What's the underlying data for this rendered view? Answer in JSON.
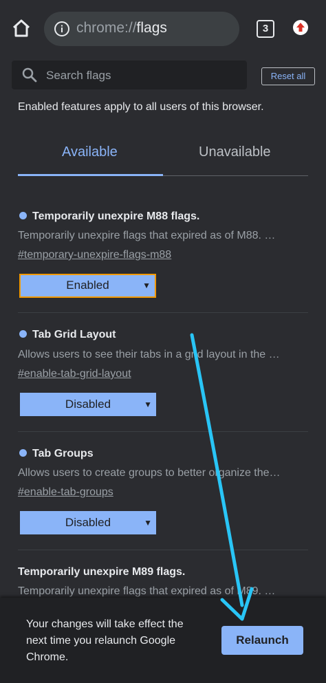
{
  "toolbar": {
    "url_scheme": "chrome://",
    "url_path": "flags",
    "tab_count": "3",
    "home_icon": "home-icon",
    "info_icon": "info-icon",
    "update_icon": "update-arrow-icon"
  },
  "search": {
    "placeholder": "Search flags",
    "value": "",
    "reset_label": "Reset all"
  },
  "notice": "Enabled features apply to all users of this browser.",
  "tabs": [
    {
      "label": "Available",
      "active": true
    },
    {
      "label": "Unavailable",
      "active": false
    }
  ],
  "flags": [
    {
      "title": "Temporarily unexpire M88 flags.",
      "description": "Temporarily unexpire flags that expired as of M88. …",
      "link": "#temporary-unexpire-flags-m88",
      "value": "Enabled",
      "dot": true
    },
    {
      "title": "Tab Grid Layout",
      "description": "Allows users to see their tabs in a grid layout in the …",
      "link": "#enable-tab-grid-layout",
      "value": "Disabled",
      "dot": true
    },
    {
      "title": "Tab Groups",
      "description": "Allows users to create groups to better organize the…",
      "link": "#enable-tab-groups",
      "value": "Disabled",
      "dot": true
    },
    {
      "title": "Temporarily unexpire M89 flags.",
      "description": "Temporarily unexpire flags that expired as of M89. …",
      "link": "",
      "value": "",
      "dot": false
    }
  ],
  "infobar": {
    "message": "Your changes will take effect the next time you relaunch Google Chrome.",
    "button_label": "Relaunch"
  },
  "colors": {
    "accent": "#8ab4f8",
    "background": "#2b2c30",
    "annotation_arrow": "#29c5f6",
    "focus_border": "#f29900"
  }
}
